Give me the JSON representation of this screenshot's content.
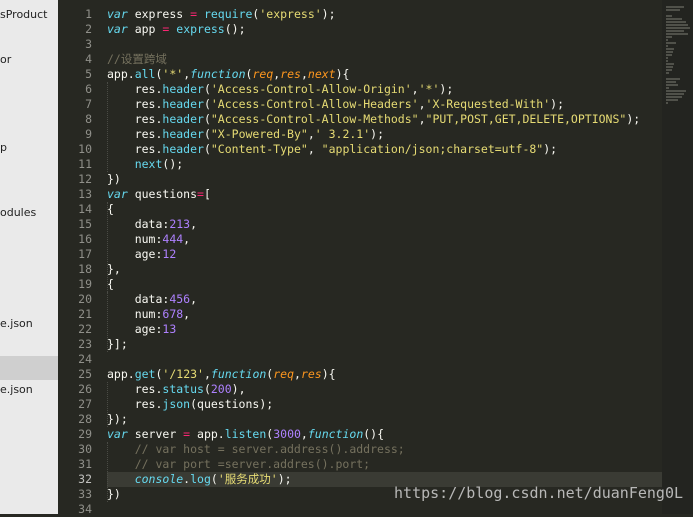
{
  "sidebar": {
    "items": [
      {
        "label": "sProduct"
      },
      {
        "label": "or"
      },
      {
        "label": "p"
      },
      {
        "label": "odules"
      },
      {
        "label": "e.json"
      },
      {
        "label": "e.json"
      }
    ]
  },
  "editor": {
    "line_numbers": [
      "1",
      "2",
      "3",
      "4",
      "5",
      "6",
      "7",
      "8",
      "9",
      "10",
      "11",
      "12",
      "13",
      "14",
      "15",
      "16",
      "17",
      "18",
      "19",
      "20",
      "21",
      "22",
      "23",
      "24",
      "25",
      "26",
      "27",
      "28",
      "29",
      "30",
      "31",
      "32",
      "33",
      "34"
    ],
    "active_line": "32",
    "lines": [
      [
        {
          "t": "var",
          "c": "kw"
        },
        {
          "t": " express "
        },
        {
          "t": "=",
          "c": "o"
        },
        {
          "t": " require",
          "c": "f"
        },
        {
          "t": "("
        },
        {
          "t": "'express'",
          "c": "s"
        },
        {
          "t": ");"
        }
      ],
      [
        {
          "t": "var",
          "c": "kw"
        },
        {
          "t": " app "
        },
        {
          "t": "=",
          "c": "o"
        },
        {
          "t": " express",
          "c": "f"
        },
        {
          "t": "();"
        }
      ],
      [],
      [
        {
          "t": "//设置跨域",
          "c": "c"
        }
      ],
      [
        {
          "t": "app."
        },
        {
          "t": "all",
          "c": "f"
        },
        {
          "t": "("
        },
        {
          "t": "'*'",
          "c": "s"
        },
        {
          "t": ","
        },
        {
          "t": "function",
          "c": "kw"
        },
        {
          "t": "("
        },
        {
          "t": "req",
          "c": "p"
        },
        {
          "t": ","
        },
        {
          "t": "res",
          "c": "p"
        },
        {
          "t": ","
        },
        {
          "t": "next",
          "c": "p"
        },
        {
          "t": "){"
        }
      ],
      [
        {
          "t": "    res."
        },
        {
          "t": "header",
          "c": "f"
        },
        {
          "t": "("
        },
        {
          "t": "'Access-Control-Allow-Origin'",
          "c": "s"
        },
        {
          "t": ","
        },
        {
          "t": "'*'",
          "c": "s"
        },
        {
          "t": ");"
        }
      ],
      [
        {
          "t": "    res."
        },
        {
          "t": "header",
          "c": "f"
        },
        {
          "t": "("
        },
        {
          "t": "'Access-Control-Allow-Headers'",
          "c": "s"
        },
        {
          "t": ","
        },
        {
          "t": "'X-Requested-With'",
          "c": "s"
        },
        {
          "t": ");"
        }
      ],
      [
        {
          "t": "    res."
        },
        {
          "t": "header",
          "c": "f"
        },
        {
          "t": "("
        },
        {
          "t": "\"Access-Control-Allow-Methods\"",
          "c": "s"
        },
        {
          "t": ","
        },
        {
          "t": "\"PUT,POST,GET,DELETE,OPTIONS\"",
          "c": "s"
        },
        {
          "t": ");"
        }
      ],
      [
        {
          "t": "    res."
        },
        {
          "t": "header",
          "c": "f"
        },
        {
          "t": "("
        },
        {
          "t": "\"X-Powered-By\"",
          "c": "s"
        },
        {
          "t": ","
        },
        {
          "t": "' 3.2.1'",
          "c": "s"
        },
        {
          "t": ");"
        }
      ],
      [
        {
          "t": "    res."
        },
        {
          "t": "header",
          "c": "f"
        },
        {
          "t": "("
        },
        {
          "t": "\"Content-Type\"",
          "c": "s"
        },
        {
          "t": ", "
        },
        {
          "t": "\"application/json;charset=utf-8\"",
          "c": "s"
        },
        {
          "t": ");"
        }
      ],
      [
        {
          "t": "    "
        },
        {
          "t": "next",
          "c": "f"
        },
        {
          "t": "();"
        }
      ],
      [
        {
          "t": "})"
        }
      ],
      [
        {
          "t": "var",
          "c": "kw"
        },
        {
          "t": " questions"
        },
        {
          "t": "=",
          "c": "o"
        },
        {
          "t": "["
        }
      ],
      [
        {
          "t": "{"
        }
      ],
      [
        {
          "t": "    data:"
        },
        {
          "t": "213",
          "c": "n"
        },
        {
          "t": ","
        }
      ],
      [
        {
          "t": "    num:"
        },
        {
          "t": "444",
          "c": "n"
        },
        {
          "t": ","
        }
      ],
      [
        {
          "t": "    age:"
        },
        {
          "t": "12",
          "c": "n"
        }
      ],
      [
        {
          "t": "},"
        }
      ],
      [
        {
          "t": "{"
        }
      ],
      [
        {
          "t": "    data:"
        },
        {
          "t": "456",
          "c": "n"
        },
        {
          "t": ","
        }
      ],
      [
        {
          "t": "    num:"
        },
        {
          "t": "678",
          "c": "n"
        },
        {
          "t": ","
        }
      ],
      [
        {
          "t": "    age:"
        },
        {
          "t": "13",
          "c": "n"
        }
      ],
      [
        {
          "t": "}];"
        }
      ],
      [],
      [
        {
          "t": "app."
        },
        {
          "t": "get",
          "c": "f"
        },
        {
          "t": "("
        },
        {
          "t": "'/123'",
          "c": "s"
        },
        {
          "t": ","
        },
        {
          "t": "function",
          "c": "kw"
        },
        {
          "t": "("
        },
        {
          "t": "req",
          "c": "p"
        },
        {
          "t": ","
        },
        {
          "t": "res",
          "c": "p"
        },
        {
          "t": "){"
        }
      ],
      [
        {
          "t": "    res."
        },
        {
          "t": "status",
          "c": "f"
        },
        {
          "t": "("
        },
        {
          "t": "200",
          "c": "n"
        },
        {
          "t": "),"
        }
      ],
      [
        {
          "t": "    res."
        },
        {
          "t": "json",
          "c": "f"
        },
        {
          "t": "(questions);"
        }
      ],
      [
        {
          "t": "});"
        }
      ],
      [
        {
          "t": "var",
          "c": "kw"
        },
        {
          "t": " server "
        },
        {
          "t": "=",
          "c": "o"
        },
        {
          "t": " app."
        },
        {
          "t": "listen",
          "c": "f"
        },
        {
          "t": "("
        },
        {
          "t": "3000",
          "c": "n"
        },
        {
          "t": ","
        },
        {
          "t": "function",
          "c": "kw"
        },
        {
          "t": "(){"
        }
      ],
      [
        {
          "t": "    // var host = server.address().address;",
          "c": "c"
        }
      ],
      [
        {
          "t": "    // var port =server.addres().port;",
          "c": "c"
        }
      ],
      [
        {
          "t": "    "
        },
        {
          "t": "console",
          "c": "kw"
        },
        {
          "t": "."
        },
        {
          "t": "log",
          "c": "f"
        },
        {
          "t": "("
        },
        {
          "t": "'服务成功'",
          "c": "s"
        },
        {
          "t": ");"
        }
      ],
      [
        {
          "t": "})"
        }
      ],
      []
    ]
  },
  "watermark": {
    "text": "https://blog.csdn.net/duanFeng0L"
  }
}
